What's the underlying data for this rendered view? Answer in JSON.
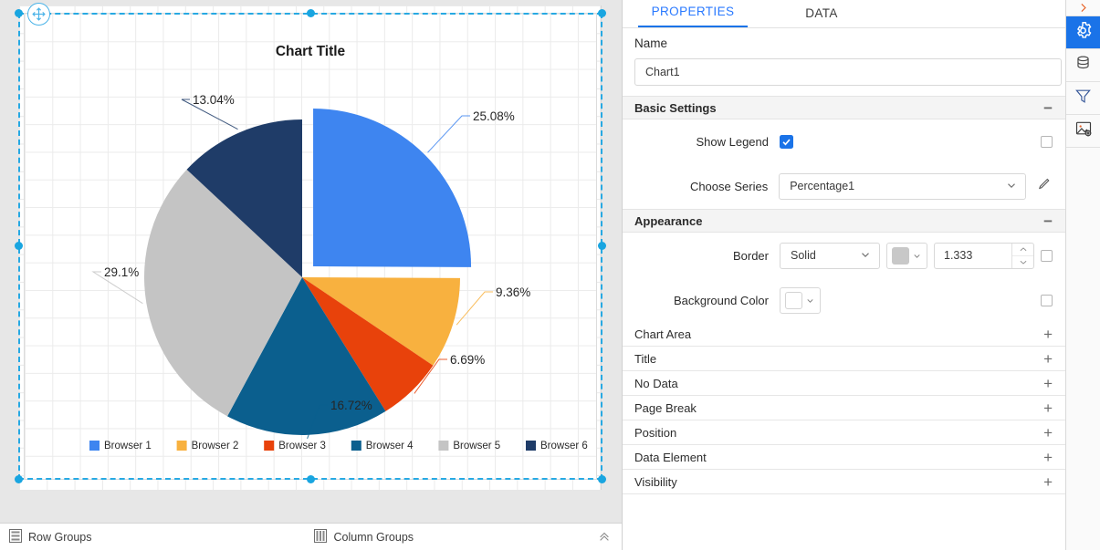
{
  "canvas": {
    "move_handle_icon": "move-cross-icon"
  },
  "chart": {
    "title": "Chart Title"
  },
  "chart_data": {
    "type": "pie",
    "title": "Chart Title",
    "xlabel": "",
    "ylabel": "",
    "legend_position": "bottom",
    "grid": true,
    "exploded_slice_index": 0,
    "categories": [
      "Browser 1",
      "Browser 2",
      "Browser 3",
      "Browser 4",
      "Browser 5",
      "Browser 6"
    ],
    "values": [
      25.08,
      9.36,
      6.69,
      16.72,
      29.1,
      13.04
    ],
    "labels": [
      "25.08%",
      "9.36%",
      "6.69%",
      "16.72%",
      "29.1%",
      "13.04%"
    ],
    "colors": [
      "#3E85F0",
      "#F8B13F",
      "#E8420B",
      "#0B5F8E",
      "#C4C4C4",
      "#1F3C68"
    ],
    "legend": [
      {
        "label": "Browser 1",
        "color": "#3E85F0"
      },
      {
        "label": "Browser 2",
        "color": "#F8B13F"
      },
      {
        "label": "Browser 3",
        "color": "#E8420B"
      },
      {
        "label": "Browser 4",
        "color": "#0B5F8E"
      },
      {
        "label": "Browser 5",
        "color": "#C4C4C4"
      },
      {
        "label": "Browser 6",
        "color": "#1F3C68"
      }
    ]
  },
  "groups_bar": {
    "row_groups": "Row Groups",
    "column_groups": "Column Groups",
    "row_groups_icon": "rows-icon",
    "column_groups_icon": "columns-icon",
    "collapse_icon": "chevron-double-up-icon"
  },
  "panel": {
    "tabs": [
      {
        "label": "PROPERTIES",
        "active": true
      },
      {
        "label": "DATA",
        "active": false
      }
    ],
    "name": {
      "label": "Name",
      "value": "Chart1",
      "placeholder": "Name"
    },
    "basic_settings": {
      "title": "Basic Settings",
      "sign": "−",
      "show_legend": {
        "label": "Show Legend",
        "checked": true
      },
      "choose_series": {
        "label": "Choose Series",
        "value": "Percentage1",
        "dropdown_icon": "chevron-down-icon",
        "edit_icon": "pencil-icon"
      }
    },
    "appearance": {
      "title": "Appearance",
      "sign": "−",
      "border": {
        "label": "Border",
        "style_value": "Solid",
        "color": "#C8C8C8",
        "width_value": "1.333",
        "dropdown_icon": "chevron-down-icon",
        "spinner_up_icon": "chevron-up-icon",
        "spinner_down_icon": "chevron-down-icon"
      },
      "background_color": {
        "label": "Background Color",
        "color": "#FFFFFF",
        "dropdown_icon": "chevron-down-icon"
      }
    },
    "collapsed_sections": [
      {
        "label": "Chart Area",
        "sign": "+"
      },
      {
        "label": "Title",
        "sign": "+"
      },
      {
        "label": "No Data",
        "sign": "+"
      },
      {
        "label": "Page Break",
        "sign": "+"
      },
      {
        "label": "Position",
        "sign": "+"
      },
      {
        "label": "Data Element",
        "sign": "+"
      },
      {
        "label": "Visibility",
        "sign": "+"
      }
    ]
  },
  "rail": {
    "items": [
      {
        "icon": "chevron-right-icon",
        "active": false
      },
      {
        "icon": "gear-icon",
        "active": true
      },
      {
        "icon": "database-icon",
        "active": false
      },
      {
        "icon": "filter-icon",
        "active": false
      },
      {
        "icon": "image-settings-icon",
        "active": false
      }
    ]
  },
  "colors": {
    "accent": "#1a73e8",
    "selection": "#19a5e0",
    "rail_expand": "#e8642a"
  }
}
